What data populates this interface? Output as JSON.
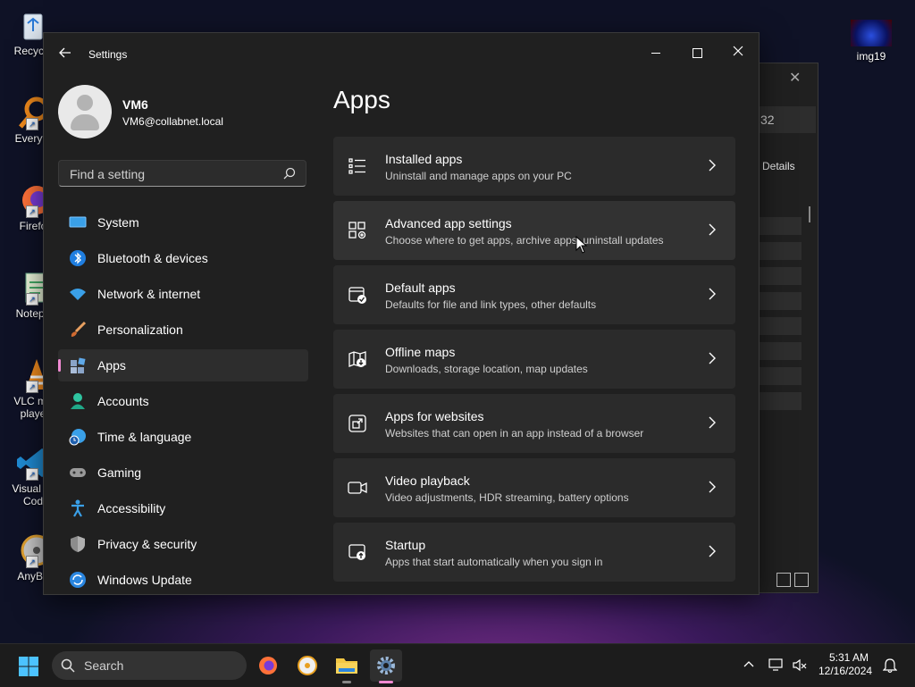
{
  "desktop": {
    "icons": [
      {
        "label": "Recycle",
        "icon": "recycle-bin-icon"
      },
      {
        "label": "Everyth",
        "icon": "everything-search-icon"
      },
      {
        "label": "Firefo",
        "icon": "firefox-icon"
      },
      {
        "label": "Notepa",
        "icon": "notepad-icon"
      },
      {
        "label": "VLC me\nplaye",
        "icon": "vlc-icon"
      },
      {
        "label": "Visual St\nCod",
        "icon": "vscode-icon"
      },
      {
        "label": "AnyBu",
        "icon": "anyburn-icon"
      }
    ],
    "right_icon": {
      "label": "img19",
      "icon": "image-thumbnail-icon"
    },
    "bg_window": {
      "field_text": "32",
      "details_label": "Details"
    }
  },
  "settings": {
    "window_title": "Settings",
    "profile": {
      "name": "VM6",
      "email": "VM6@collabnet.local"
    },
    "search_placeholder": "Find a setting",
    "nav": [
      {
        "label": "System",
        "icon": "system-icon",
        "active": false
      },
      {
        "label": "Bluetooth & devices",
        "icon": "bluetooth-icon",
        "active": false
      },
      {
        "label": "Network & internet",
        "icon": "wifi-icon",
        "active": false
      },
      {
        "label": "Personalization",
        "icon": "brush-icon",
        "active": false
      },
      {
        "label": "Apps",
        "icon": "apps-icon",
        "active": true
      },
      {
        "label": "Accounts",
        "icon": "accounts-icon",
        "active": false
      },
      {
        "label": "Time & language",
        "icon": "clock-globe-icon",
        "active": false
      },
      {
        "label": "Gaming",
        "icon": "gamepad-icon",
        "active": false
      },
      {
        "label": "Accessibility",
        "icon": "accessibility-icon",
        "active": false
      },
      {
        "label": "Privacy & security",
        "icon": "shield-icon",
        "active": false
      },
      {
        "label": "Windows Update",
        "icon": "update-icon",
        "active": false
      }
    ],
    "page_title": "Apps",
    "cards": [
      {
        "title": "Installed apps",
        "subtitle": "Uninstall and manage apps on your PC",
        "icon": "list-icon"
      },
      {
        "title": "Advanced app settings",
        "subtitle": "Choose where to get apps, archive apps, uninstall updates",
        "icon": "app-settings-icon"
      },
      {
        "title": "Default apps",
        "subtitle": "Defaults for file and link types, other defaults",
        "icon": "default-apps-icon"
      },
      {
        "title": "Offline maps",
        "subtitle": "Downloads, storage location, map updates",
        "icon": "map-icon"
      },
      {
        "title": "Apps for websites",
        "subtitle": "Websites that can open in an app instead of a browser",
        "icon": "open-in-app-icon"
      },
      {
        "title": "Video playback",
        "subtitle": "Video adjustments, HDR streaming, battery options",
        "icon": "video-camera-icon"
      },
      {
        "title": "Startup",
        "subtitle": "Apps that start automatically when you sign in",
        "icon": "startup-icon"
      }
    ]
  },
  "taskbar": {
    "search_label": "Search",
    "time": "5:31 AM",
    "date": "12/16/2024",
    "accent": "#f08ad2"
  }
}
